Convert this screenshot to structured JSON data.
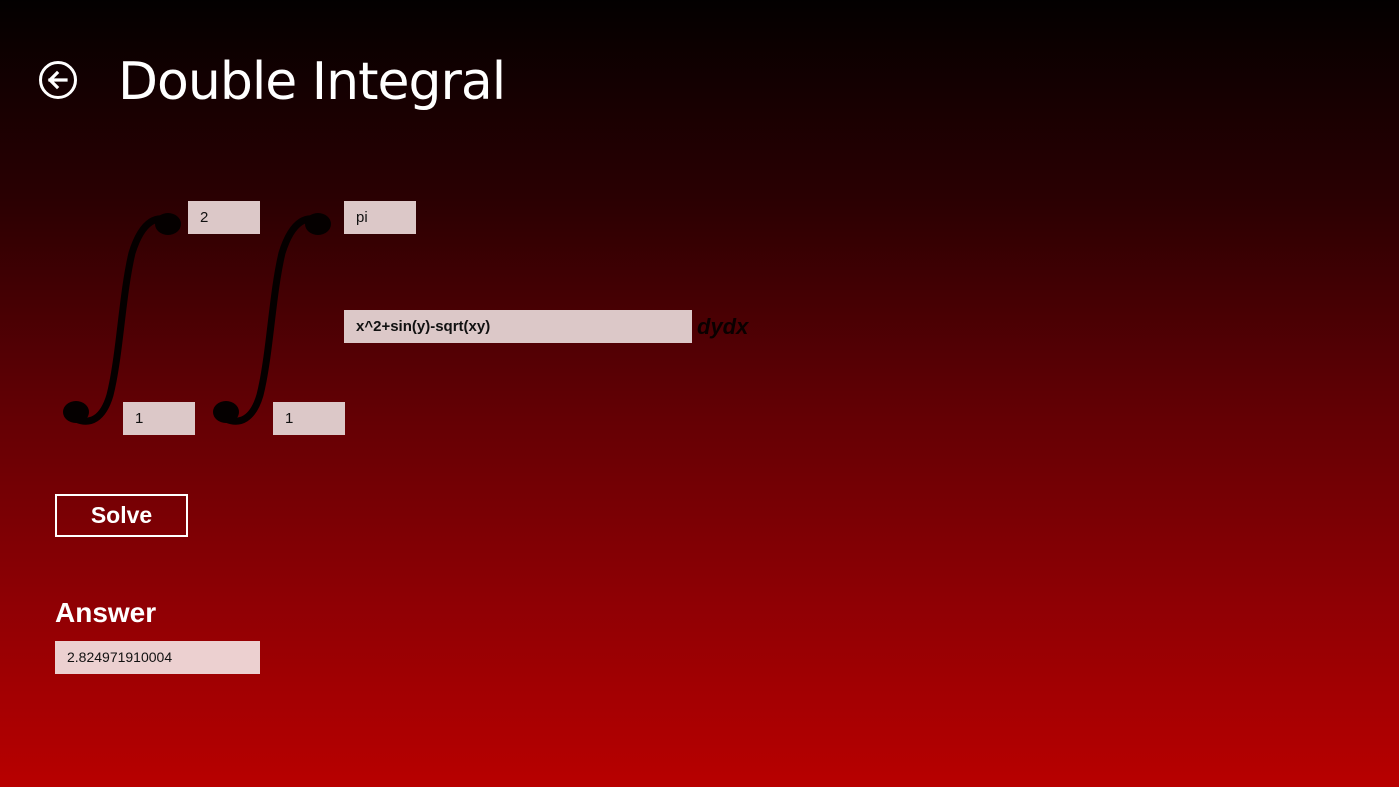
{
  "header": {
    "title": "Double Integral",
    "back_icon": "arrow-left-circle-icon"
  },
  "integral": {
    "outer_upper": "2",
    "outer_lower": "1",
    "inner_upper": "pi",
    "inner_lower": "1",
    "expression": "x^2+sin(y)-sqrt(xy)",
    "differential": "dydx"
  },
  "actions": {
    "solve_label": "Solve"
  },
  "result": {
    "label": "Answer",
    "value": "2.824971910004"
  },
  "colors": {
    "background_top": "#030000",
    "background_bottom": "#b80000",
    "field_background": "#dcc8c8",
    "text": "#ffffff"
  }
}
